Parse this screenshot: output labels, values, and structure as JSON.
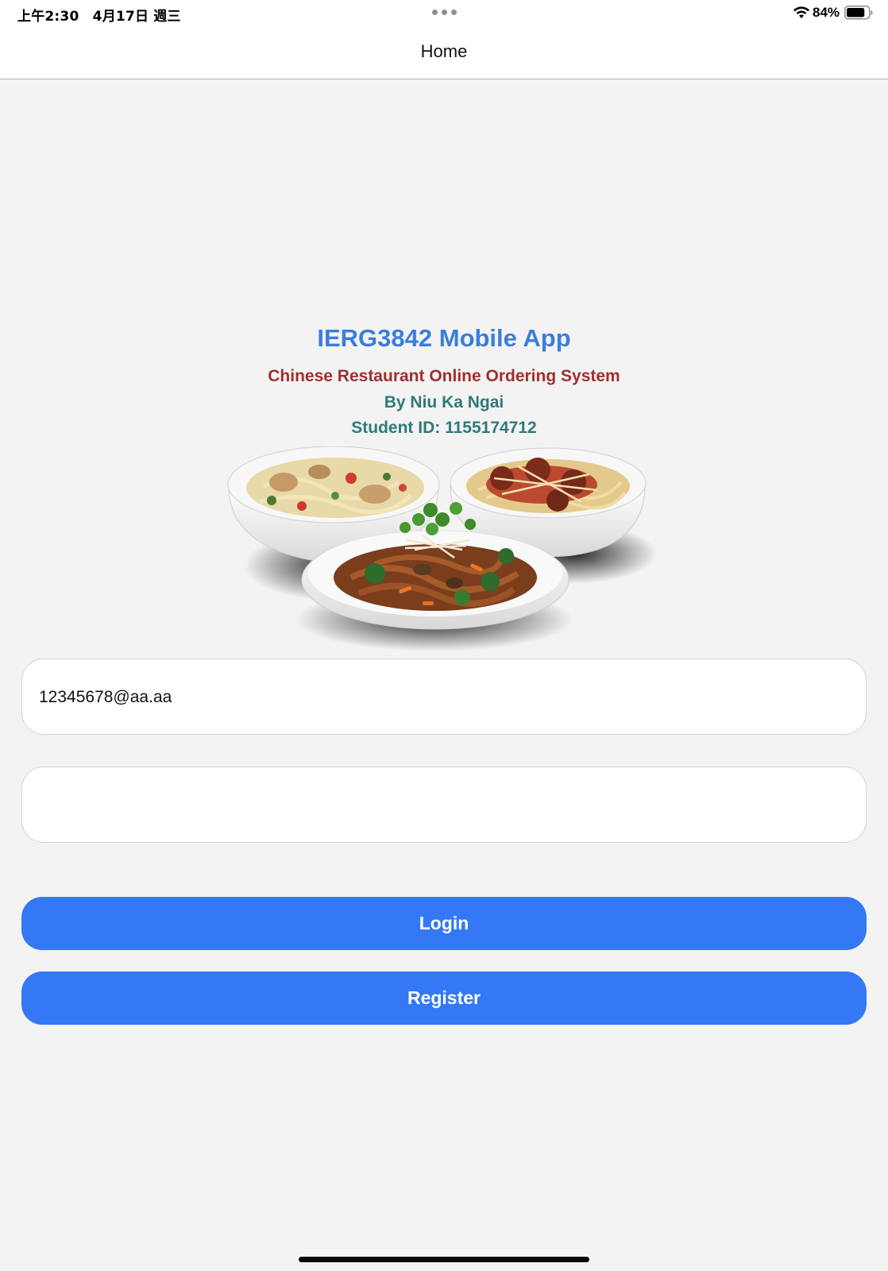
{
  "status_bar": {
    "time": "上午2:30　4月17日 週三",
    "battery_percent": "84%",
    "battery_level": 0.84,
    "icons": [
      "wifi-icon",
      "battery-icon",
      "multitasking-dots-icon"
    ]
  },
  "nav": {
    "title": "Home"
  },
  "header": {
    "title": "IERG3842 Mobile App",
    "subtitle": "Chinese Restaurant Online Ordering System",
    "author": "By Niu Ka Ngai",
    "student_id": "Student ID: 1155174712"
  },
  "form": {
    "email_value": "12345678@aa.aa",
    "password_value": ""
  },
  "buttons": {
    "login_label": "Login",
    "register_label": "Register"
  },
  "colors": {
    "title": "#3b7ddd",
    "subtitle": "#a12f2f",
    "author": "#2e7a7c",
    "button": "#3478f6",
    "background": "#f3f3f3"
  }
}
